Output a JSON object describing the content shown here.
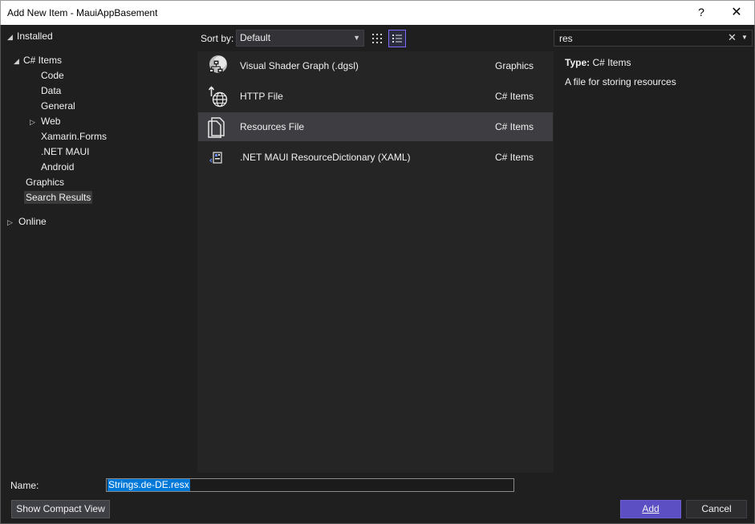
{
  "window": {
    "title": "Add New Item - MauiAppBasement",
    "help": "?",
    "close": "✕"
  },
  "tree": {
    "installed": "Installed",
    "csharp_items": "C# Items",
    "code": "Code",
    "data": "Data",
    "general": "General",
    "web": "Web",
    "xamarin_forms": "Xamarin.Forms",
    "net_maui": ".NET MAUI",
    "android": "Android",
    "graphics": "Graphics",
    "search_results": "Search Results",
    "online": "Online"
  },
  "toolbar": {
    "sort_label": "Sort by:",
    "sort_value": "Default"
  },
  "search": {
    "value": "res",
    "clear": "✕"
  },
  "templates": [
    {
      "name": "Visual Shader Graph (.dgsl)",
      "category": "Graphics",
      "icon": "shader-graph-icon"
    },
    {
      "name": "HTTP File",
      "category": "C# Items",
      "icon": "http-file-icon"
    },
    {
      "name": "Resources File",
      "category": "C# Items",
      "icon": "resources-file-icon",
      "selected": true
    },
    {
      "name": ".NET MAUI ResourceDictionary (XAML)",
      "category": "C# Items",
      "icon": "xaml-icon"
    }
  ],
  "details": {
    "type_key": "Type:",
    "type_value": "C# Items",
    "description": "A file for storing resources"
  },
  "footer": {
    "name_label": "Name:",
    "name_value": "Strings.de-DE.resx",
    "compact_label": "Show Compact View",
    "add_label": "Add",
    "cancel_label": "Cancel"
  },
  "colors": {
    "accent": "#5c4ec3",
    "selection": "#0078d7",
    "background": "#1f1f1f"
  }
}
